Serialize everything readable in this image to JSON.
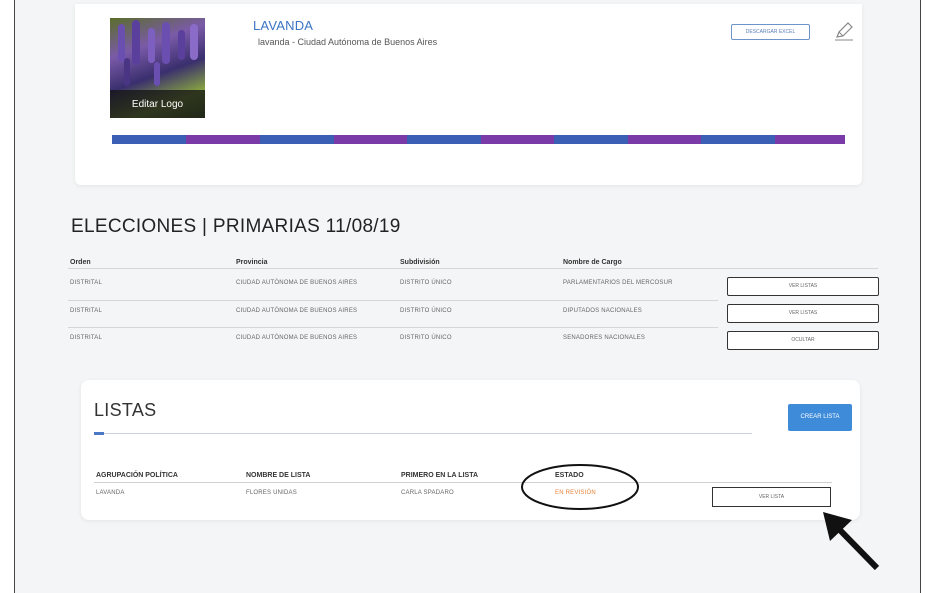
{
  "profile": {
    "name": "LAVANDA",
    "subtitle": "lavanda - Ciudad Autónoma de Buenos Aires",
    "edit_logo_label": "Editar Logo",
    "download_excel_label": "DESCARGAR EXCEL",
    "edit_icon": "pencil-icon",
    "progress_colors": [
      "#3a5fb5",
      "#7a3aa8"
    ]
  },
  "elections": {
    "title": "ELECCIONES | PRIMARIAS 11/08/19",
    "headers": [
      "Orden",
      "Provincia",
      "Subdivisión",
      "Nombre de Cargo"
    ],
    "rows": [
      {
        "orden": "DISTRITAL",
        "provincia": "CIUDAD AUTÓNOMA DE BUENOS AIRES",
        "subdivision": "DISTRITO ÚNICO",
        "cargo": "PARLAMENTARIOS DEL MERCOSUR",
        "action": "VER LISTAS"
      },
      {
        "orden": "DISTRITAL",
        "provincia": "CIUDAD AUTÓNOMA DE BUENOS AIRES",
        "subdivision": "DISTRITO ÚNICO",
        "cargo": "DIPUTADOS NACIONALES",
        "action": "VER LISTAS"
      },
      {
        "orden": "DISTRITAL",
        "provincia": "CIUDAD AUTÓNOMA DE BUENOS AIRES",
        "subdivision": "DISTRITO ÚNICO",
        "cargo": "SENADORES NACIONALES",
        "action": "OCULTAR"
      }
    ]
  },
  "listas": {
    "title": "LISTAS",
    "create_label": "CREAR LISTA",
    "headers": [
      "AGRUPACIÓN POLÍTICA",
      "NOMBRE DE LISTA",
      "PRIMERO EN LA LISTA",
      "ESTADO"
    ],
    "row": {
      "agrupacion": "LAVANDA",
      "nombre": "FLORES UNIDAS",
      "primero": "CARLA SPADARO",
      "estado": "EN REVISIÓN",
      "action": "VER LISTA"
    },
    "colors": {
      "accent": "#3d8bd9",
      "estado": "#e8833a"
    }
  },
  "annotations": {
    "circle_target": "ESTADO",
    "arrow_target": "VER LISTA"
  }
}
